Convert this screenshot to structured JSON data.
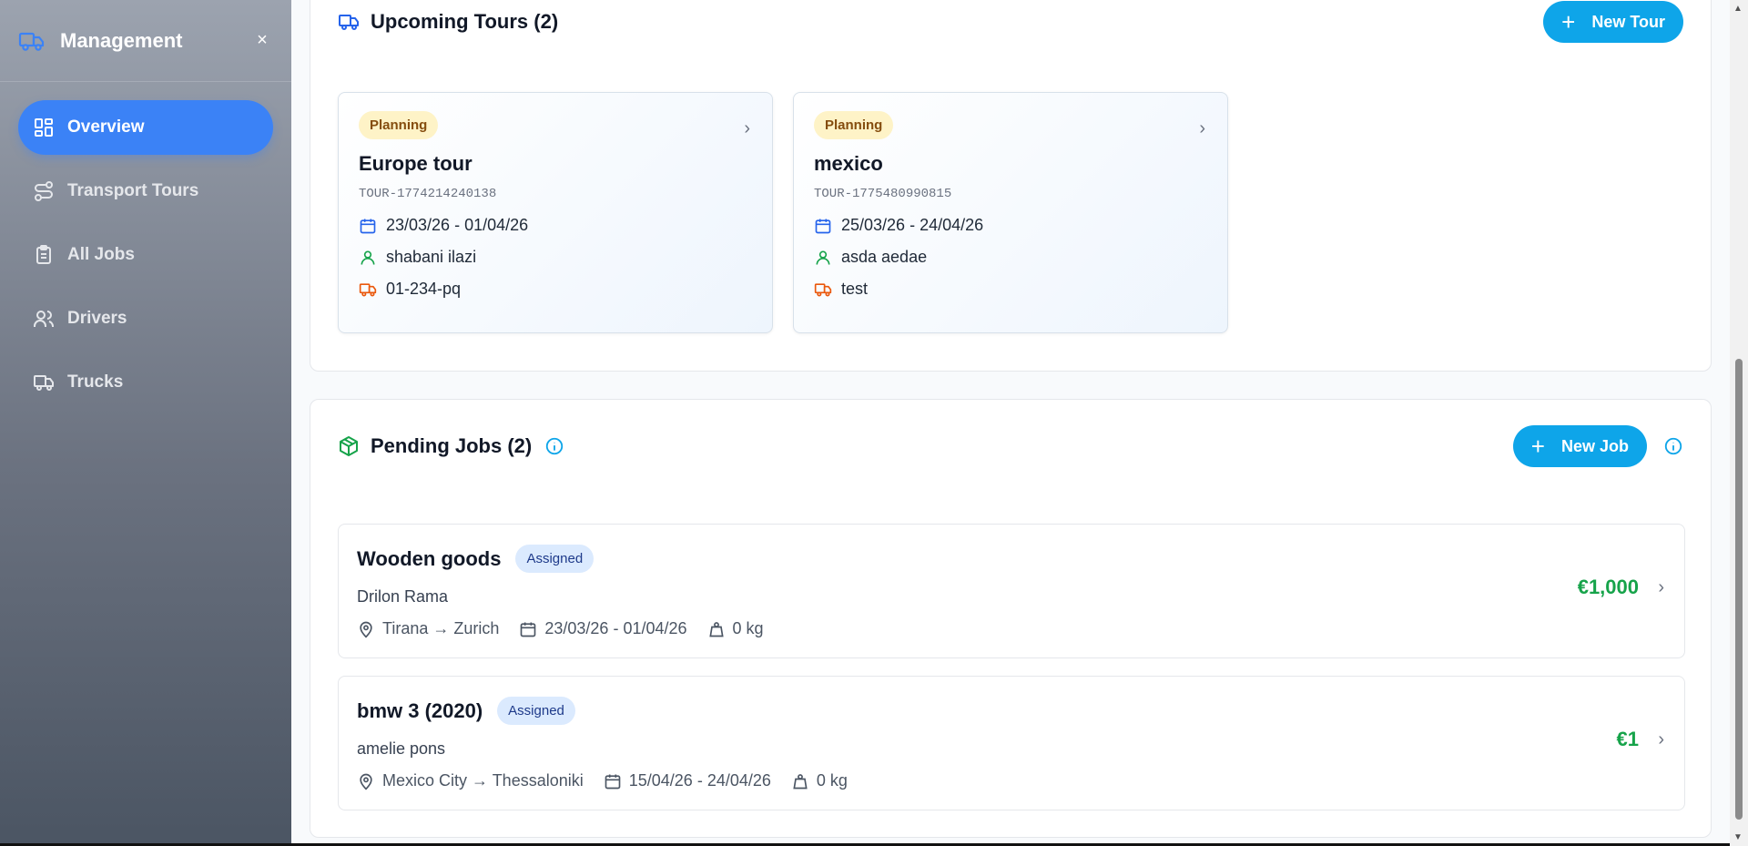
{
  "sidebar": {
    "title": "Management",
    "close_icon": "×",
    "items": [
      {
        "label": "Overview",
        "icon": "grid-icon",
        "active": true
      },
      {
        "label": "Transport Tours",
        "icon": "route-icon"
      },
      {
        "label": "All Jobs",
        "icon": "clipboard-icon"
      },
      {
        "label": "Drivers",
        "icon": "users-icon"
      },
      {
        "label": "Trucks",
        "icon": "truck-icon"
      }
    ]
  },
  "tours": {
    "title": "Upcoming Tours (2)",
    "new_button": "New Tour",
    "cards": [
      {
        "status": "Planning",
        "name": "Europe tour",
        "code": "TOUR-1774214240138",
        "dates": "23/03/26 - 01/04/26",
        "driver": "shabani ilazi",
        "truck": "01-234-pq"
      },
      {
        "status": "Planning",
        "name": "mexico",
        "code": "TOUR-1775480990815",
        "dates": "25/03/26 - 24/04/26",
        "driver": "asda aedae",
        "truck": "test"
      }
    ]
  },
  "jobs": {
    "title": "Pending Jobs (2)",
    "new_button": "New Job",
    "items": [
      {
        "name": "Wooden goods",
        "status": "Assigned",
        "client": "Drilon Rama",
        "route": "Tirana → Zurich",
        "dates": "23/03/26 - 01/04/26",
        "weight": "0 kg",
        "price": "€1,000"
      },
      {
        "name": "bmw 3 (2020)",
        "status": "Assigned",
        "client": "amelie pons",
        "route": "Mexico City → Thessaloniki",
        "dates": "15/04/26 - 24/04/26",
        "weight": "0 kg",
        "price": "€1"
      }
    ]
  },
  "colors": {
    "accent": "#3b82f6",
    "button": "#0ea5e9",
    "price": "#16a34a",
    "planning_badge": "#fef3c7",
    "assigned_badge": "#dbeafe"
  }
}
